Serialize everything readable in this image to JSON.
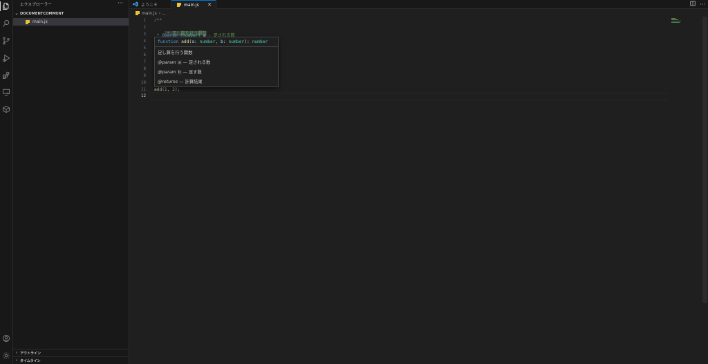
{
  "sidebar": {
    "header": "エクスプローラー",
    "more": "···",
    "folder": "DOCUMENTCOMMENT",
    "file": "main.js",
    "panels": [
      "アウトライン",
      "タイムライン"
    ]
  },
  "tabs": {
    "welcome": "ようこそ",
    "main": "main.js",
    "close": "✕"
  },
  "breadcrumb": {
    "file": "main.js",
    "rest": "›  ..."
  },
  "editor": {
    "line_numbers": [
      "1",
      "2",
      "3",
      "4",
      "5",
      "6",
      "7",
      "8",
      "9",
      "10",
      "11",
      "12"
    ],
    "current_line": "12",
    "lines": {
      "l1": "/**",
      "l2": " * 足し算を行う関数",
      "l3_a": " * ",
      "l3_tag": "@param",
      "l3_type": "{number}",
      "l3_name": "a",
      "l3_desc": " - 足される数",
      "l11_fn": "add",
      "l11_open": "(",
      "l11_n1": "1",
      "l11_sep": ", ",
      "l11_n2": "2",
      "l11_close": ");"
    }
  },
  "hover": {
    "kw": "function",
    "name": "add",
    "p1": "a",
    "p2": "b",
    "type": "number",
    "colon": ": ",
    "open": "(",
    "sep": ", ",
    "close": ")",
    "summary": "足し算を行う関数",
    "param_tag": "@param",
    "param_a": "a",
    "param_a_desc": "— 足される数",
    "param_b": "b",
    "param_b_desc": "— 足す数",
    "returns_tag": "@returns",
    "returns_desc": "— 計算結果"
  },
  "colors": {
    "accent": "#0078d4",
    "comment": "#6a9955",
    "keyword": "#569cd6",
    "type": "#4ec9b0",
    "function": "#dcdcaa",
    "js_icon": "#e8c431"
  },
  "icons": {
    "activity": [
      "files-icon",
      "search-icon",
      "source-control-icon",
      "run-debug-icon",
      "extensions-icon",
      "remote-explorer-icon",
      "package-icon",
      "account-icon",
      "settings-gear-icon"
    ],
    "tab_actions": [
      "split-editor-icon",
      "more-actions-icon"
    ]
  }
}
